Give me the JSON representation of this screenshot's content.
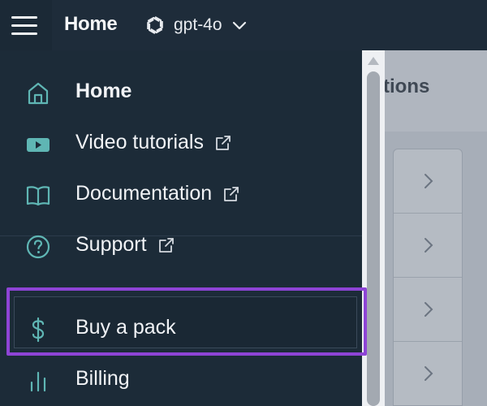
{
  "header": {
    "title": "Home",
    "menu_icon": "hamburger-icon",
    "model": {
      "name": "gpt-4o",
      "logo_icon": "openai-logo-icon",
      "chevron_icon": "chevron-down-icon"
    }
  },
  "nav": {
    "items": [
      {
        "label": "Home",
        "icon": "home-icon",
        "external": false,
        "active": true
      },
      {
        "label": "Video tutorials",
        "icon": "video-icon",
        "external": true
      },
      {
        "label": "Documentation",
        "icon": "book-icon",
        "external": true
      },
      {
        "label": "Support",
        "icon": "question-circle-icon",
        "external": true
      },
      {
        "label": "Buy a pack",
        "icon": "dollar-icon",
        "external": false,
        "highlighted": true
      },
      {
        "label": "Billing",
        "icon": "bar-chart-icon",
        "external": false
      }
    ]
  },
  "background_page": {
    "header_fragment": "tions"
  },
  "colors": {
    "drawer_bg": "#1c2b38",
    "icon_accent": "#5fb6b4",
    "highlight_border": "#8e44d6",
    "text": "#f1f3f6"
  }
}
